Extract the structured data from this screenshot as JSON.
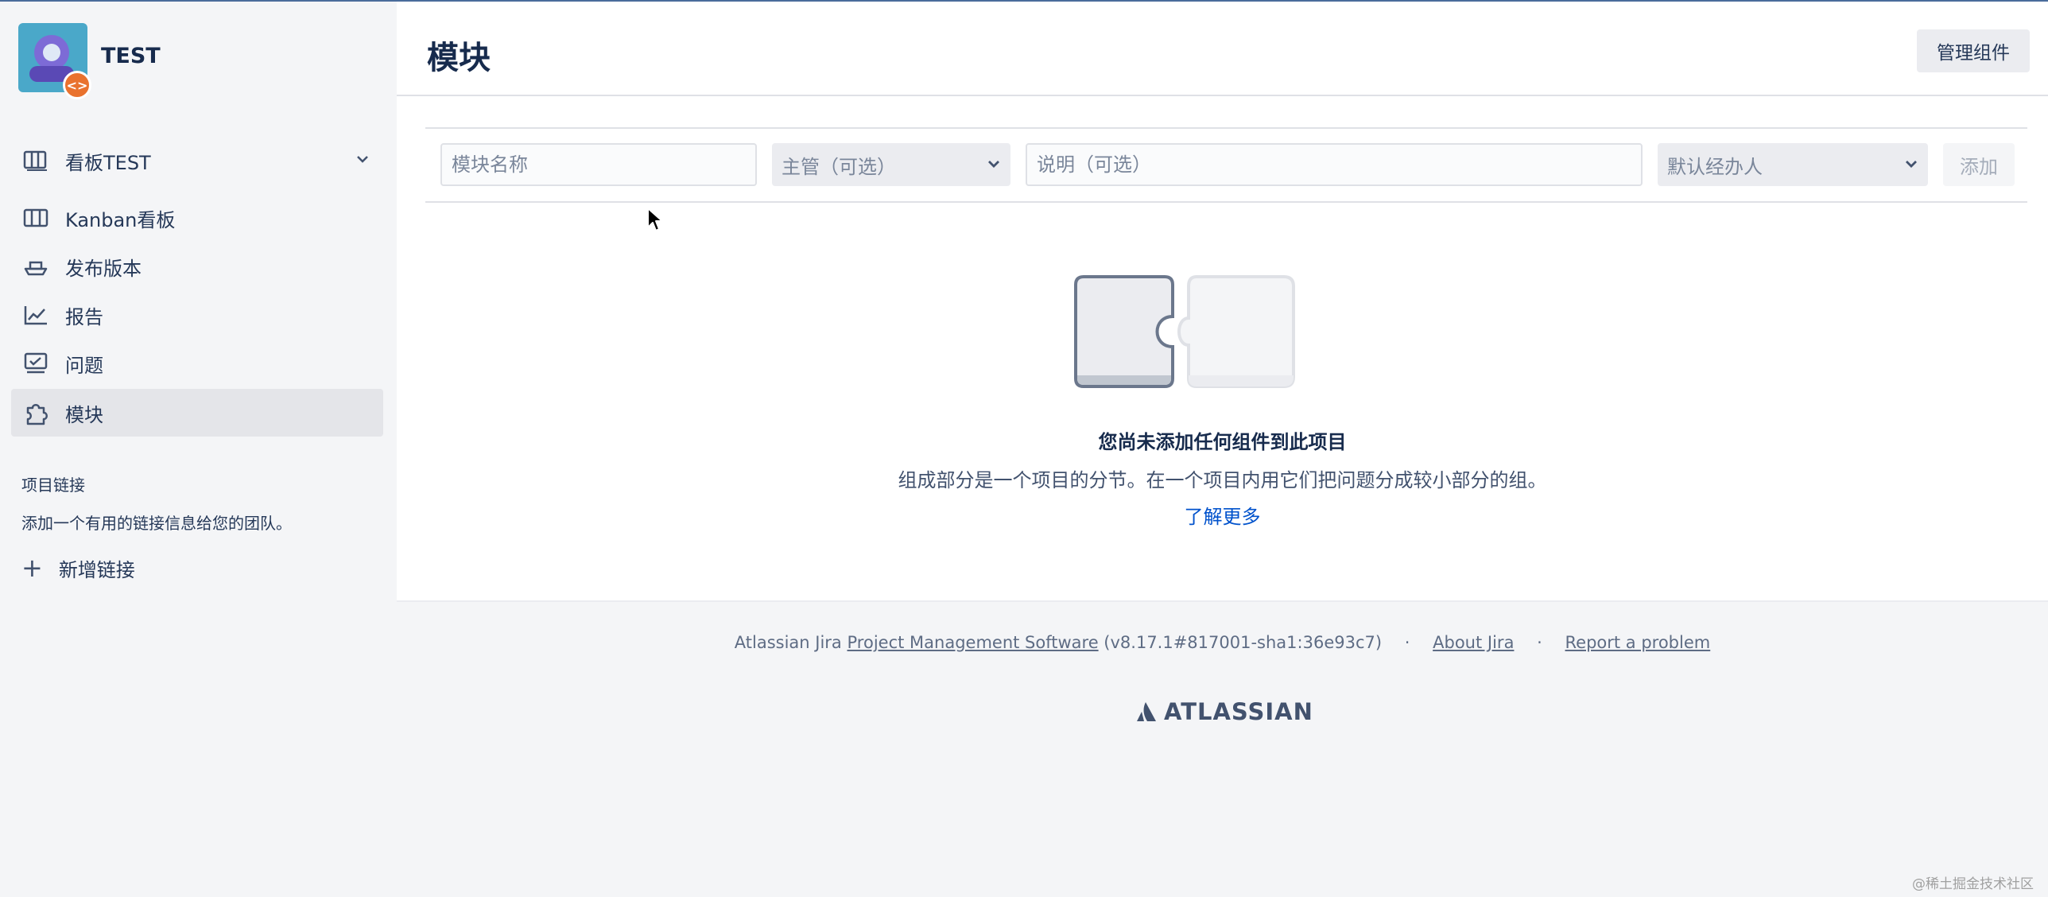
{
  "sidebar": {
    "project_name": "TEST",
    "project_badge": "<>",
    "nav": [
      {
        "label": "看板TEST",
        "icon": "board-icon",
        "has_dropdown": true
      },
      {
        "label": "Kanban看板",
        "icon": "kanban-icon"
      },
      {
        "label": "发布版本",
        "icon": "ship-icon"
      },
      {
        "label": "报告",
        "icon": "chart-line-icon"
      },
      {
        "label": "问题",
        "icon": "issues-icon"
      },
      {
        "label": "模块",
        "icon": "puzzle-icon",
        "active": true
      }
    ],
    "project_links": {
      "title": "项目链接",
      "description": "添加一个有用的链接信息给您的团队。",
      "add_label": "新增链接"
    }
  },
  "main": {
    "title": "模块",
    "manage_button": "管理组件",
    "form": {
      "name_placeholder": "模块名称",
      "lead_placeholder": "主管（可选）",
      "description_placeholder": "说明（可选）",
      "assignee_placeholder": "默认经办人",
      "add_button": "添加"
    },
    "empty_state": {
      "title": "您尚未添加任何组件到此项目",
      "description": "组成部分是一个项目的分节。在一个项目内用它们把问题分成较小部分的组。",
      "learn_more": "了解更多"
    }
  },
  "footer": {
    "prefix": "Atlassian Jira",
    "pms_link": "Project Management Software",
    "version": "(v8.17.1#817001-sha1:36e93c7)",
    "separator": "·",
    "about_link": "About Jira",
    "report_link": "Report a problem",
    "logo_text": "ATLASSIAN"
  },
  "watermark": "@稀土掘金技术社区",
  "colors": {
    "sidebar_bg": "#f4f5f7",
    "main_bg": "#ffffff",
    "link": "#0052cc",
    "text": "#172b4d",
    "active_item_bg": "#e4e5e9",
    "badge": "#e9722e"
  }
}
